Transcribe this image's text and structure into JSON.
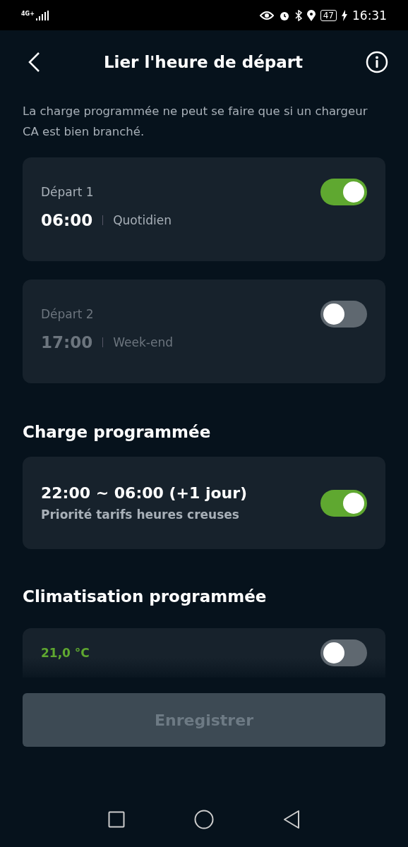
{
  "status_bar": {
    "network": "4G+",
    "battery": "47",
    "time": "16:31"
  },
  "header": {
    "title": "Lier l'heure de départ"
  },
  "note": "La charge programmée ne peut se faire que si un chargeur CA est bien branché.",
  "departures": [
    {
      "label": "Départ 1",
      "time": "06:00",
      "repeat": "Quotidien",
      "on": true
    },
    {
      "label": "Départ 2",
      "time": "17:00",
      "repeat": "Week-end",
      "on": false
    }
  ],
  "charge": {
    "title": "Charge programmée",
    "range": "22:00 ~ 06:00 (+1 jour)",
    "mode": "Priorité tarifs heures creuses",
    "on": true
  },
  "climate": {
    "title": "Climatisation programmée",
    "temperature": "21,0 °C",
    "on": false
  },
  "save_button": {
    "label": "Enregistrer",
    "disabled": true
  }
}
